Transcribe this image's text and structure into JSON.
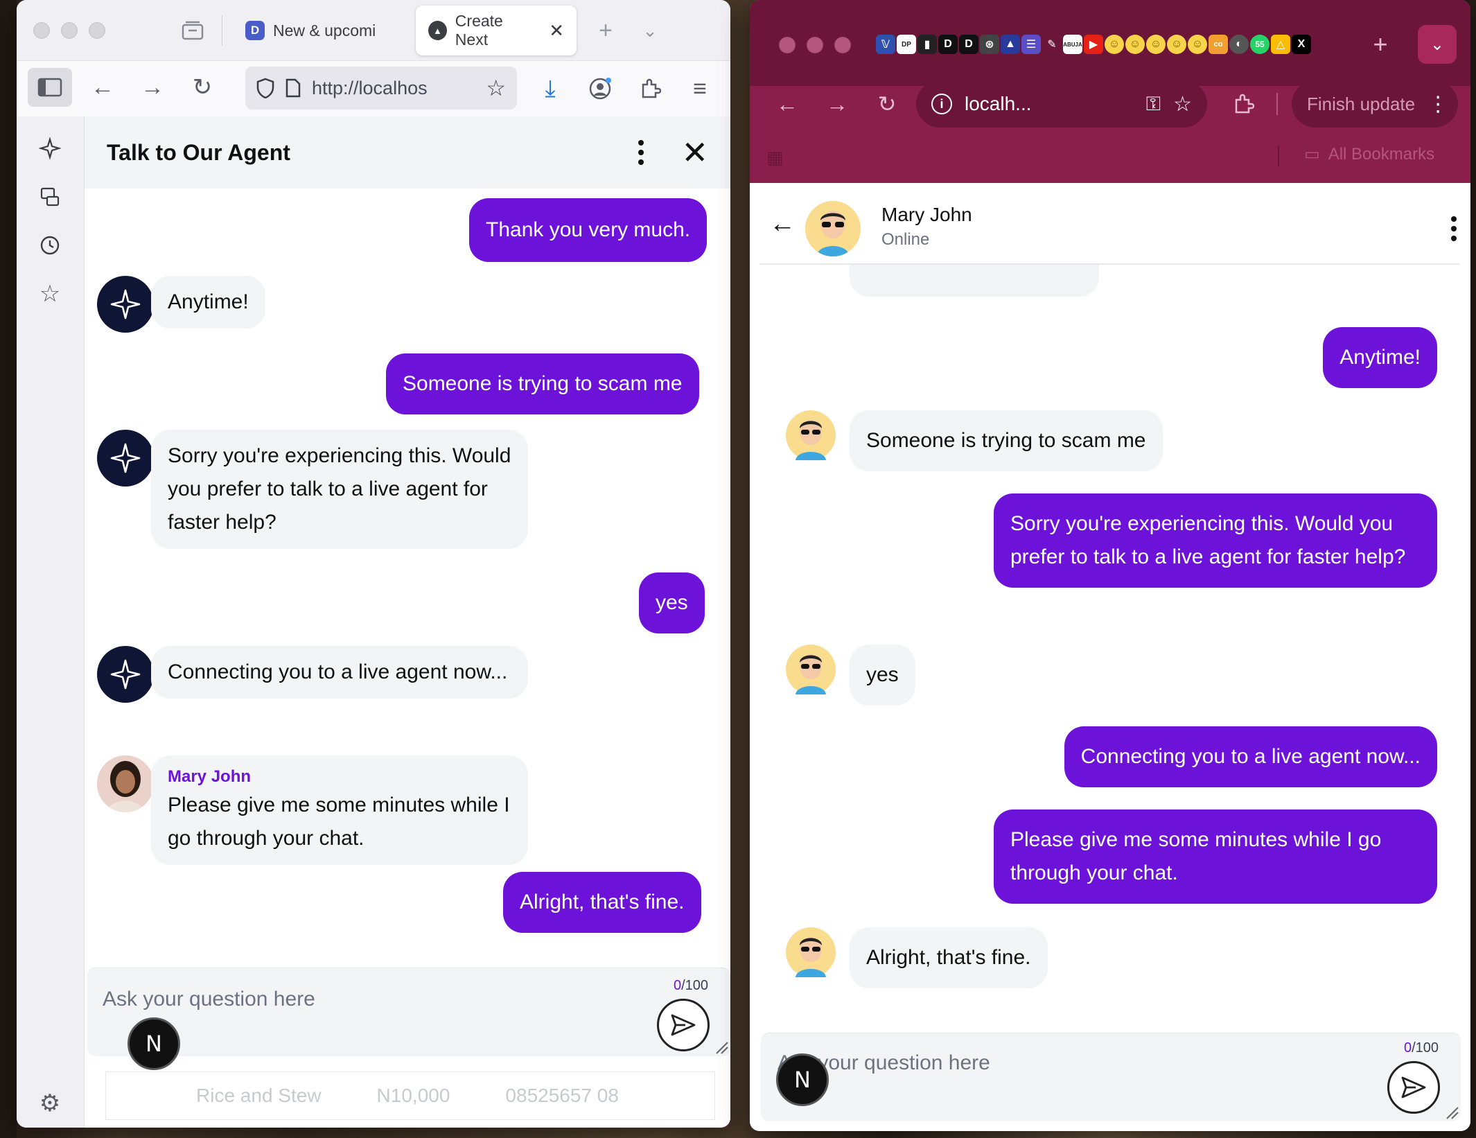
{
  "firefox": {
    "tabs": [
      {
        "label": "New & upcomi",
        "favicon": "D"
      },
      {
        "label": "Create Next",
        "favicon": "▲"
      }
    ],
    "url": "http://localhos",
    "chat": {
      "title": "Talk to Our Agent",
      "messages": [
        {
          "role": "user",
          "text": "Thank you very much."
        },
        {
          "role": "bot",
          "text": "Anytime!"
        },
        {
          "role": "user",
          "text": "Someone is trying to scam me"
        },
        {
          "role": "bot",
          "text": "Sorry you're experiencing this. Would you prefer to talk to a live agent for faster help?"
        },
        {
          "role": "user",
          "text": "yes"
        },
        {
          "role": "bot",
          "text": "Connecting you to a live agent now..."
        },
        {
          "role": "agent",
          "name": "Mary John",
          "text": "Please give me some minutes while I go through your chat."
        },
        {
          "role": "user",
          "text": "Alright, that's fine."
        }
      ],
      "input_placeholder": "Ask your question here",
      "counter_current": "0",
      "counter_max": "/100",
      "n_badge": "N",
      "below_row": {
        "item": "Rice and Stew",
        "amount": "N10,000",
        "phone": "08525657 08"
      }
    }
  },
  "chrome": {
    "url": "localh...",
    "finish_update": "Finish update",
    "bookmarks": "All Bookmarks",
    "chat": {
      "contact_name": "Mary John",
      "contact_status": "Online",
      "messages": [
        {
          "role": "agent",
          "text": "Anytime!"
        },
        {
          "role": "customer",
          "text": "Someone is trying to scam me"
        },
        {
          "role": "agent",
          "text": "Sorry you're experiencing this. Would you prefer to talk to a live agent for faster help?"
        },
        {
          "role": "customer",
          "text": "yes"
        },
        {
          "role": "agent",
          "text": "Connecting you to a live agent now..."
        },
        {
          "role": "agent",
          "text": "Please give me some minutes while I go through your chat."
        },
        {
          "role": "customer",
          "text": "Alright, that's fine."
        }
      ],
      "input_placeholder": "Ask your question here",
      "counter_current": "0",
      "counter_max": "/100",
      "n_badge": "N"
    }
  },
  "colors": {
    "brand_purple": "#6d12d9",
    "chrome_theme": "#8b1f4c",
    "bubble_grey": "#f3f4f6"
  }
}
